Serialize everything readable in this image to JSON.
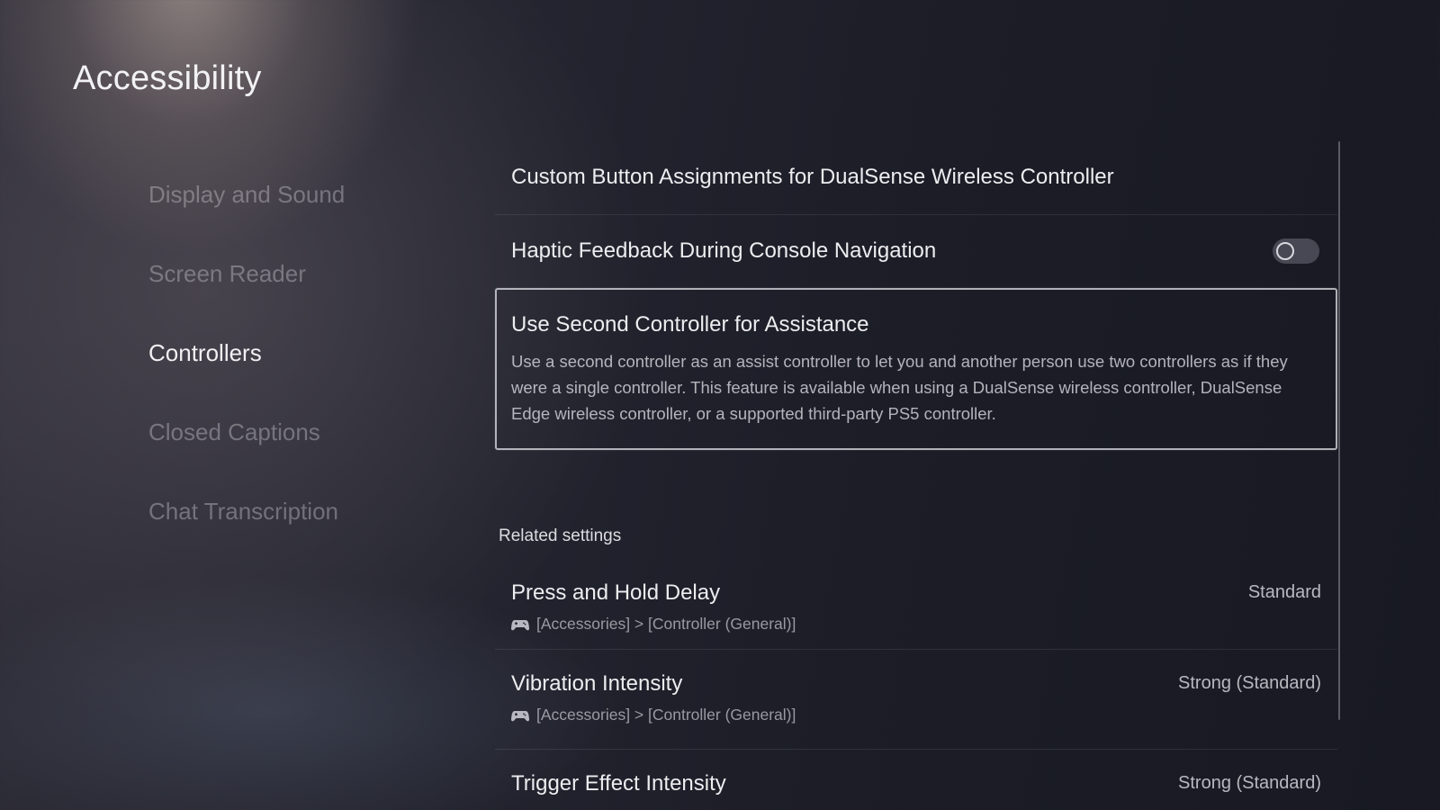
{
  "page": {
    "title": "Accessibility"
  },
  "sidebar": {
    "items": [
      {
        "label": "Display and Sound",
        "active": false
      },
      {
        "label": "Screen Reader",
        "active": false
      },
      {
        "label": "Controllers",
        "active": true
      },
      {
        "label": "Closed Captions",
        "active": false
      },
      {
        "label": "Chat Transcription",
        "active": false
      }
    ]
  },
  "settings": {
    "custom_buttons": {
      "title": "Custom Button Assignments for DualSense Wireless Controller"
    },
    "haptic": {
      "title": "Haptic Feedback During Console Navigation",
      "toggle_on": false
    },
    "second_controller": {
      "title": "Use Second Controller for Assistance",
      "description": "Use a second controller as an assist controller to let you and another person use two controllers as if they were a single controller. This feature is available when using a DualSense wireless controller, DualSense Edge wireless controller, or a supported third-party PS5 controller."
    }
  },
  "related": {
    "heading": "Related settings",
    "items": [
      {
        "title": "Press and Hold Delay",
        "path": "[Accessories] > [Controller (General)]",
        "value": "Standard",
        "icon": "controller-icon"
      },
      {
        "title": "Vibration Intensity",
        "path": "[Accessories] > [Controller (General)]",
        "value": "Strong (Standard)",
        "icon": "controller-icon"
      },
      {
        "title": "Trigger Effect Intensity",
        "value": "Strong (Standard)"
      }
    ]
  },
  "colors": {
    "text_primary": "#ededf0",
    "text_inactive": "#c8c6cd",
    "focus_border": "#e1e1e8"
  }
}
